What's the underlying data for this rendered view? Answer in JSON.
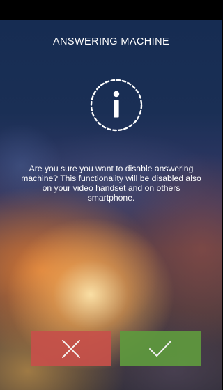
{
  "dialog": {
    "title": "ANSWERING MACHINE",
    "icon": "info-icon",
    "message": "Are you sure you want to disable answering machine? This functionality will be disabled also on your video handset and on others smartphone."
  },
  "actions": {
    "cancel": {
      "icon": "close-icon",
      "color": "#c7504a"
    },
    "confirm": {
      "icon": "checkmark-icon",
      "color": "#5f9a3e"
    }
  }
}
